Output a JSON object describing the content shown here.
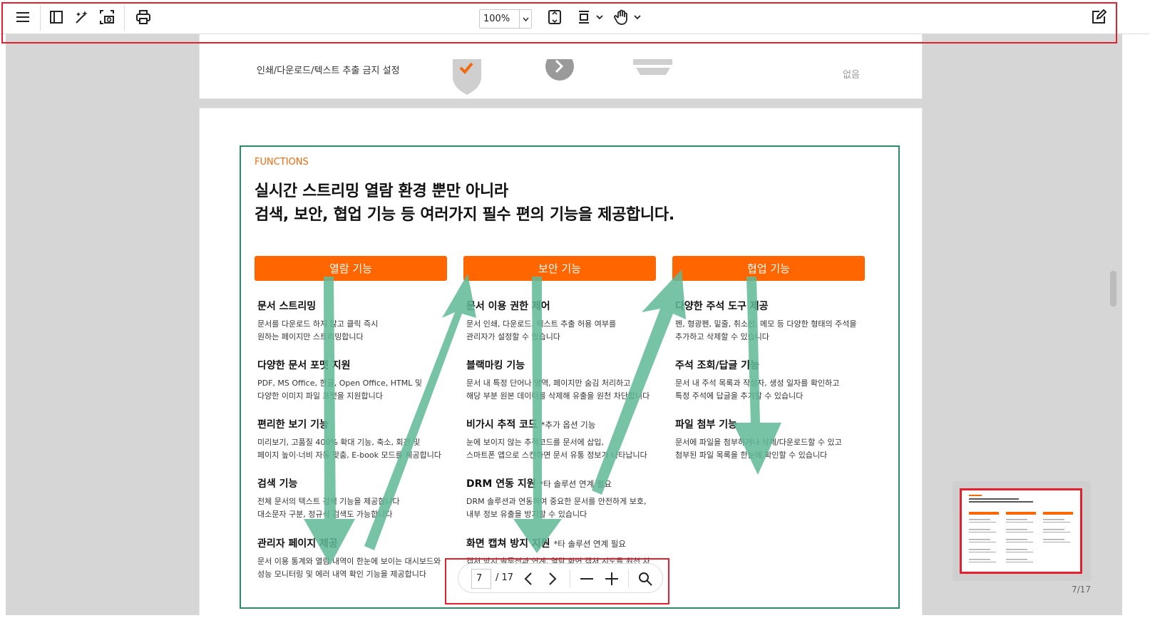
{
  "toolbar": {
    "zoom": "100%",
    "icons": {
      "menu": "menu-icon",
      "sidebar": "sidebar-toggle-icon",
      "magic": "magic-wand-icon",
      "screenshot": "screenshot-icon",
      "print": "print-icon",
      "page_fit": "fit-page-icon",
      "scroll_mode": "scroll-mode-icon",
      "pan": "hand-tool-icon",
      "edit": "edit-icon"
    }
  },
  "prev_page": {
    "left_text": "인쇄/다운로드/텍스트 추출 금지 설정",
    "right_text": "없음"
  },
  "page": {
    "section_label": "FUNCTIONS",
    "heading_line1": "실시간 스트리밍 열람 환경 뿐만 아니라",
    "heading_line2": "검색, 보안, 협업 기능 등 여러가지 필수 편의 기능을 제공합니다.",
    "columns": [
      {
        "header": "열람 기능",
        "features": [
          {
            "title": "문서 스트리밍",
            "note": "",
            "desc1": "문서를 다운로드 하지 않고 클릭 즉시",
            "desc2": "원하는 페이지만 스트리밍합니다"
          },
          {
            "title": "다양한 문서 포맷 지원",
            "note": "",
            "desc1": "PDF, MS Office, 한글, Open Office, HTML 및",
            "desc2": "다양한 이미지 파일 포맷을 지원합니다"
          },
          {
            "title": "편리한 보기 기능",
            "note": "",
            "desc1": "미리보기, 고품질 400% 확대 기능, 축소, 회전 및",
            "desc2": "페이지 높이·너비 자동 맞춤, E-book 모드를 제공합니다"
          },
          {
            "title": "검색 기능",
            "note": "",
            "desc1": "전체 문서의 텍스트 검색 기능을 제공합니다",
            "desc2": "대소문자 구분, 정규식 검색도 가능합니다"
          },
          {
            "title": "관리자 페이지 제공",
            "note": "",
            "desc1": "문서 이용 통계와 열람 내역이 한눈에 보이는 대시보드와",
            "desc2": "성능 모니터링 및 에러 내역 확인 기능을 제공합니다"
          }
        ]
      },
      {
        "header": "보안 기능",
        "features": [
          {
            "title": "문서 이용 권한 제어",
            "note": "",
            "desc1": "문서 인쇄, 다운로드, 텍스트 추출 허용 여부를",
            "desc2": "관리자가 설정할 수 있습니다"
          },
          {
            "title": "블랙마킹 기능",
            "note": "",
            "desc1": "문서 내 특정 단어나 영역, 페이지만 숨김 처리하고",
            "desc2": "해당 부분 원본 데이터를 삭제해 유출을 원천 차단합니다"
          },
          {
            "title": "비가시 추적 코드",
            "note": "*추가 옵션 기능",
            "desc1": "눈에 보이지 않는 추적코드를 문서에 삽입,",
            "desc2": "스마트폰 앱으로 스캔하면 문서 유통 정보가 나타납니다"
          },
          {
            "title": "DRM 연동 지원",
            "note": "*타 솔루션 연계 필요",
            "desc1": "DRM 솔루션과 연동하여 중요한 문서를 안전하게 보호,",
            "desc2": "내부 정보 유출을 방지할 수 있습니다"
          },
          {
            "title": "화면 캡쳐 방지 지원",
            "note": "*타 솔루션 연계 필요",
            "desc1": "캡처 방지 솔루션과 연계, 열람 화면 캡처 시도를 원천 차",
            "desc2": ""
          }
        ]
      },
      {
        "header": "협업 기능",
        "features": [
          {
            "title": "다양한 주석 도구 제공",
            "note": "",
            "desc1": "펜, 형광펜, 밑줄, 취소선, 메모 등 다양한 형태의 주석을",
            "desc2": "추가하고 삭제할 수 있습니다"
          },
          {
            "title": "주석 조회/답글 기능",
            "note": "",
            "desc1": "문서 내 주석 목록과 작성자, 생성 일자를 확인하고",
            "desc2": "특정 주석에 답글을 추가할 수 있습니다"
          },
          {
            "title": "파일 첨부 기능",
            "note": "",
            "desc1": "문서에 파일을 첨부하거나 삭제/다운로드할 수 있고",
            "desc2": "첨부된 파일 목록을 한눈에 확인할 수 있습니다"
          }
        ]
      }
    ]
  },
  "pager": {
    "current_page": "7",
    "total": "/ 17",
    "icons": {
      "prev": "chevron-left-icon",
      "next": "chevron-right-icon",
      "zoom_out": "minus-icon",
      "zoom_in": "plus-icon",
      "search": "search-icon"
    }
  },
  "thumbnail": {
    "label": "7/17"
  },
  "colors": {
    "accent": "#ff6600",
    "frame": "#2e8b6a",
    "arrow": "#5fb897",
    "highlight": "#e2202e"
  }
}
